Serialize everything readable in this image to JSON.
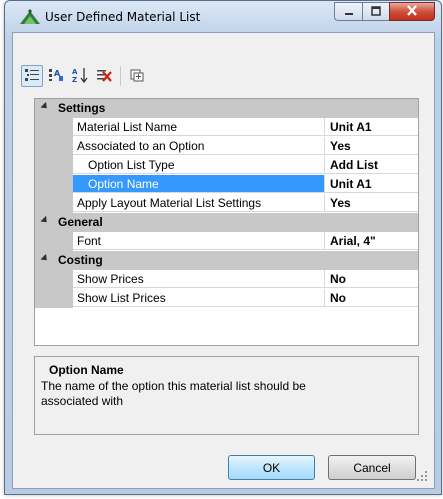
{
  "window": {
    "title": "User Defined Material List"
  },
  "toolbar": {
    "buttons": [
      {
        "icon": "categorized-view-icon",
        "pressed": true
      },
      {
        "icon": "alphabetical-edit-icon",
        "pressed": false
      },
      {
        "icon": "sort-az-icon",
        "pressed": false
      },
      {
        "icon": "delete-list-icon",
        "pressed": false
      },
      {
        "icon": "property-pages-icon",
        "pressed": false
      }
    ]
  },
  "grid": {
    "categories": [
      {
        "label": "Settings",
        "props": [
          {
            "name": "Material List Name",
            "value": "Unit A1"
          },
          {
            "name": "Associated to an Option",
            "value": "Yes"
          },
          {
            "name": "Option List Type",
            "value": "Add List"
          },
          {
            "name": "Option Name",
            "value": "Unit A1"
          },
          {
            "name": "Apply Layout Material List Settings",
            "value": "Yes"
          }
        ]
      },
      {
        "label": "General",
        "props": [
          {
            "name": "Font",
            "value": "Arial, 4\""
          }
        ]
      },
      {
        "label": "Costing",
        "props": [
          {
            "name": "Show Prices",
            "value": "No"
          },
          {
            "name": "Show List Prices",
            "value": "No"
          }
        ]
      }
    ]
  },
  "description": {
    "title": "Option Name",
    "text": "The name of the option this material list should be associated with"
  },
  "buttons": {
    "ok": "OK",
    "cancel": "Cancel"
  },
  "colors": {
    "selection": "#3399ff",
    "category_bg": "#c8c8c8",
    "close_button": "#c0301c"
  }
}
